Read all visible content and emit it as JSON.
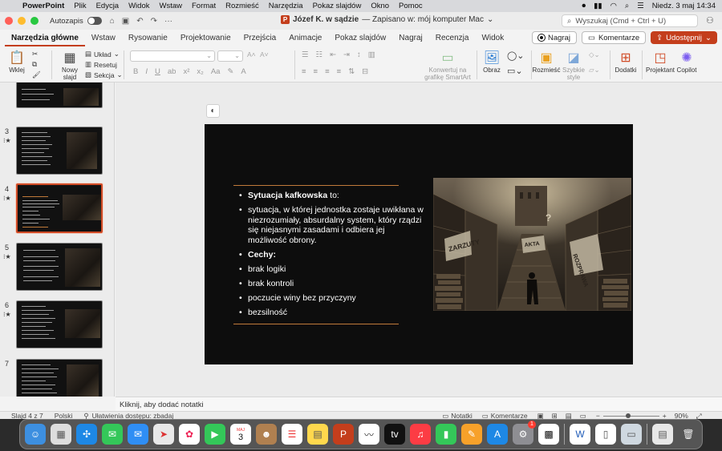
{
  "menubar": {
    "app": "PowerPoint",
    "items": [
      "Plik",
      "Edycja",
      "Widok",
      "Wstaw",
      "Format",
      "Rozmieść",
      "Narzędzia",
      "Pokaz slajdów",
      "Okno",
      "Pomoc"
    ],
    "datetime": "Niedz. 3 maj  14:34"
  },
  "titlebar": {
    "autosave_label": "Autozapis",
    "doc_name": "Józef K. w sądzie",
    "doc_status": "— Zapisano w: mój komputer Mac",
    "search_placeholder": "Wyszukaj (Cmd + Ctrl + U)"
  },
  "ribbon_tabs": [
    "Narzędzia główne",
    "Wstaw",
    "Rysowanie",
    "Projektowanie",
    "Przejścia",
    "Animacje",
    "Pokaz slajdów",
    "Nagraj",
    "Recenzja",
    "Widok"
  ],
  "ribbon_actions": {
    "record": "Nagraj",
    "comments": "Komentarze",
    "share": "Udostępnij"
  },
  "ribbon": {
    "paste": "Wklej",
    "new_slide": "Nowy\nslajd",
    "layout": "Układ",
    "reset": "Resetuj",
    "section": "Sekcja",
    "smartart": "Konwertuj na\ngrafikę SmartArt",
    "picture": "Obraz",
    "arrange": "Rozmieść",
    "quick_styles": "Szybkie\nstyle",
    "addins": "Dodatki",
    "designer": "Projektant",
    "copilot": "Copilot"
  },
  "thumbnails": [
    {
      "num": "3",
      "star": true
    },
    {
      "num": "4",
      "star": true
    },
    {
      "num": "5",
      "star": true
    },
    {
      "num": "6",
      "star": true
    },
    {
      "num": "7",
      "star": false
    }
  ],
  "slide": {
    "bullet1_bold": "Sytuacja kafkowska",
    "bullet1_rest": " to:",
    "bullet2": "sytuacja, w której jednostka zostaje uwikłana w niezrozumiały, absurdalny system, który rządzi się niejasnymi zasadami i odbiera jej możliwość obrony.",
    "bullet3": "Cechy:",
    "bullet4": "brak logiki",
    "bullet5": "brak kontroli",
    "bullet6": "poczucie winy bez przyczyny",
    "bullet7": "bezsilność",
    "art_labels": [
      "ZARZUTY",
      "AKTA",
      "ROZPRAWA"
    ]
  },
  "notes_placeholder": "Kliknij, aby dodać notatki",
  "status": {
    "slide_of": "Slajd 4 z 7",
    "language": "Polski",
    "accessibility": "Ułatwienia dostępu: zbadaj",
    "notes": "Notatki",
    "comments": "Komentarze",
    "zoom": "90%"
  },
  "dock": {
    "calendar_month": "MAJ",
    "calendar_day": "3",
    "settings_badge": "1"
  },
  "colors": {
    "accent": "#c43e1c",
    "slide_bg": "#0d0d0d",
    "rule": "#c07a3a"
  }
}
